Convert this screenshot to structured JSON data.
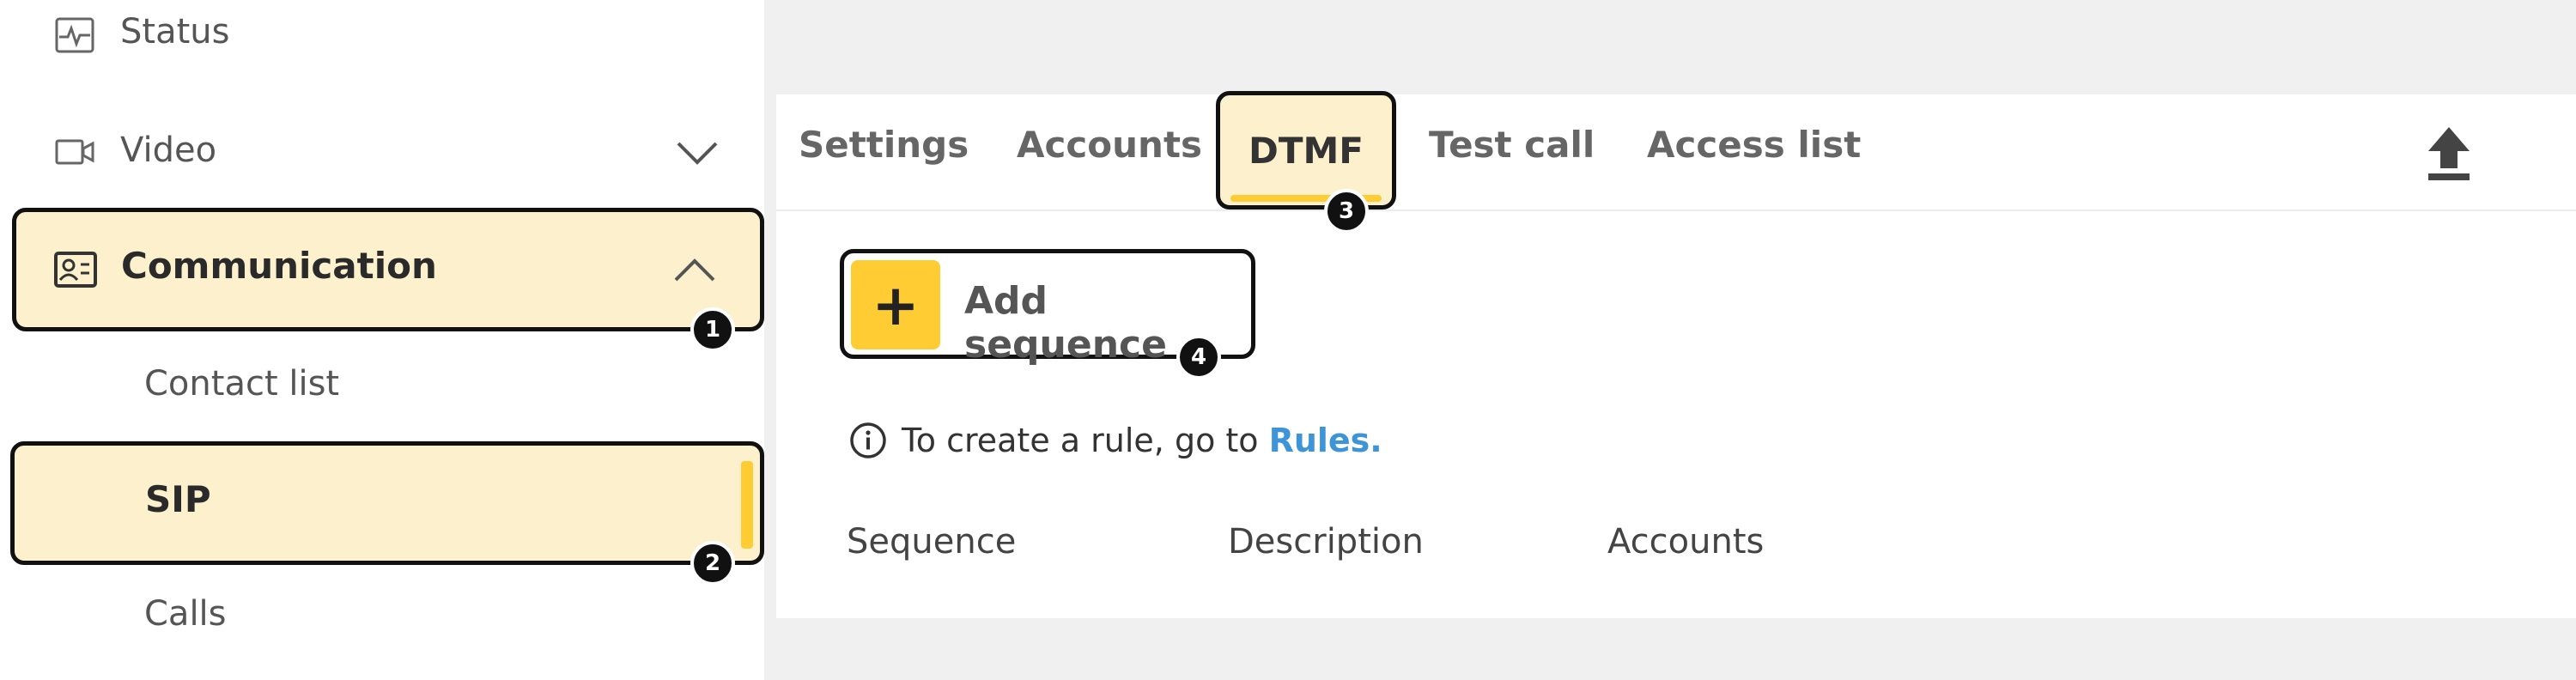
{
  "sidebar": {
    "status_label": "Status",
    "video_label": "Video",
    "communication_label": "Communication",
    "sub_items": {
      "contact_list": "Contact list",
      "sip": "SIP",
      "calls": "Calls"
    }
  },
  "tabs": {
    "settings": "Settings",
    "accounts": "Accounts",
    "dtmf": "DTMF",
    "test_call": "Test call",
    "access_list": "Access list"
  },
  "main": {
    "add_sequence_label": "Add sequence",
    "add_icon": "+",
    "info_text": "To create a rule, go to",
    "info_link": "Rules.",
    "columns": {
      "sequence": "Sequence",
      "description": "Description",
      "accounts": "Accounts"
    }
  },
  "badges": {
    "one": "1",
    "two": "2",
    "three": "3",
    "four": "4"
  },
  "colors": {
    "accent_yellow": "#ffcc33",
    "highlight_bg": "#fdf1cd",
    "link_blue": "#3d94d6"
  },
  "icons": [
    "status-icon",
    "video-icon",
    "contact-card-icon",
    "chevron-down-icon",
    "chevron-up-icon",
    "upload-icon",
    "info-icon",
    "plus-icon"
  ]
}
